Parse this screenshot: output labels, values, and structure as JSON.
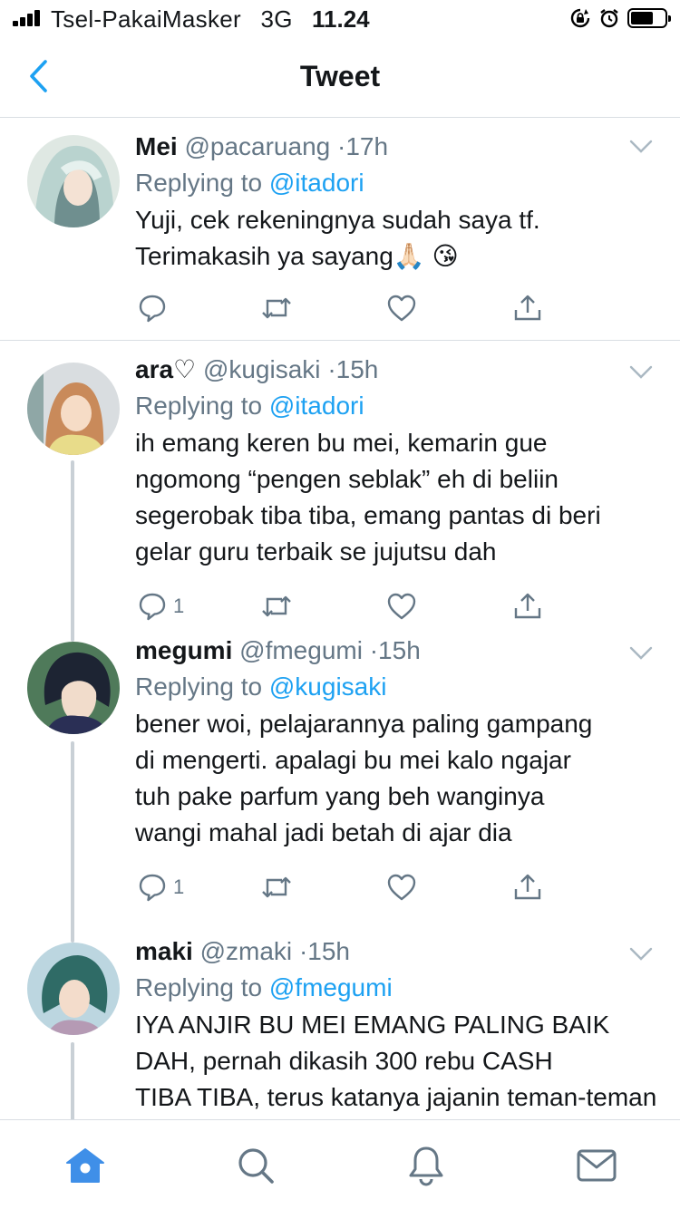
{
  "status_bar": {
    "carrier": "Tsel-PakaiMasker",
    "network": "3G",
    "time": "11.24"
  },
  "header": {
    "title": "Tweet"
  },
  "tweets": [
    {
      "name": "Mei",
      "handle": "@pacaruang",
      "time": "17h",
      "replying_label": "Replying to",
      "replying_to": "@itadori",
      "lines": [
        "Yuji, cek rekeningnya sudah saya tf.",
        "Terimakasih ya sayang🙏🏻 😘"
      ],
      "reply_count": "",
      "avatar_colors": [
        "#b9d3cf",
        "#6f8f8f"
      ]
    },
    {
      "name": "ara♡",
      "handle": "@kugisaki",
      "time": "15h",
      "replying_label": "Replying to",
      "replying_to": "@itadori",
      "lines": [
        "ih emang keren bu mei, kemarin gue",
        "ngomong “pengen seblak” eh di beliin",
        "segerobak tiba tiba, emang pantas di beri",
        "gelar guru terbaik se jujutsu dah"
      ],
      "reply_count": "1",
      "avatar_colors": [
        "#c98a5a",
        "#e9e4d8"
      ]
    },
    {
      "name": "megumi",
      "handle": "@fmegumi",
      "time": "15h",
      "replying_label": "Replying to",
      "replying_to": "@kugisaki",
      "lines": [
        "bener woi, pelajarannya paling gampang",
        "di mengerti. apalagi bu mei kalo ngajar",
        "tuh pake parfum yang beh wanginya",
        "wangi mahal jadi betah di ajar dia"
      ],
      "reply_count": "1",
      "avatar_colors": [
        "#1d2433",
        "#4f7a5a"
      ]
    },
    {
      "name": "maki",
      "handle": "@zmaki",
      "time": "15h",
      "replying_label": "Replying to",
      "replying_to": "@fmegumi",
      "lines": [
        "IYA ANJIR BU MEI EMANG PALING BAIK",
        "DAH, pernah dikasih 300 rebu CASH",
        "TIBA TIBA, terus katanya jajanin teman-teman"
      ],
      "reply_count": "",
      "avatar_colors": [
        "#2f6b66",
        "#bcd6e0"
      ]
    }
  ],
  "tab_bar": {
    "items": [
      "home-icon",
      "search-icon",
      "notifications-icon",
      "messages-icon"
    ],
    "active": "home-icon"
  },
  "colors": {
    "accent": "#1da1f2",
    "muted": "#657786",
    "divider": "#d9dee3",
    "icon": "#657786",
    "home_active": "#3f8fe8"
  }
}
